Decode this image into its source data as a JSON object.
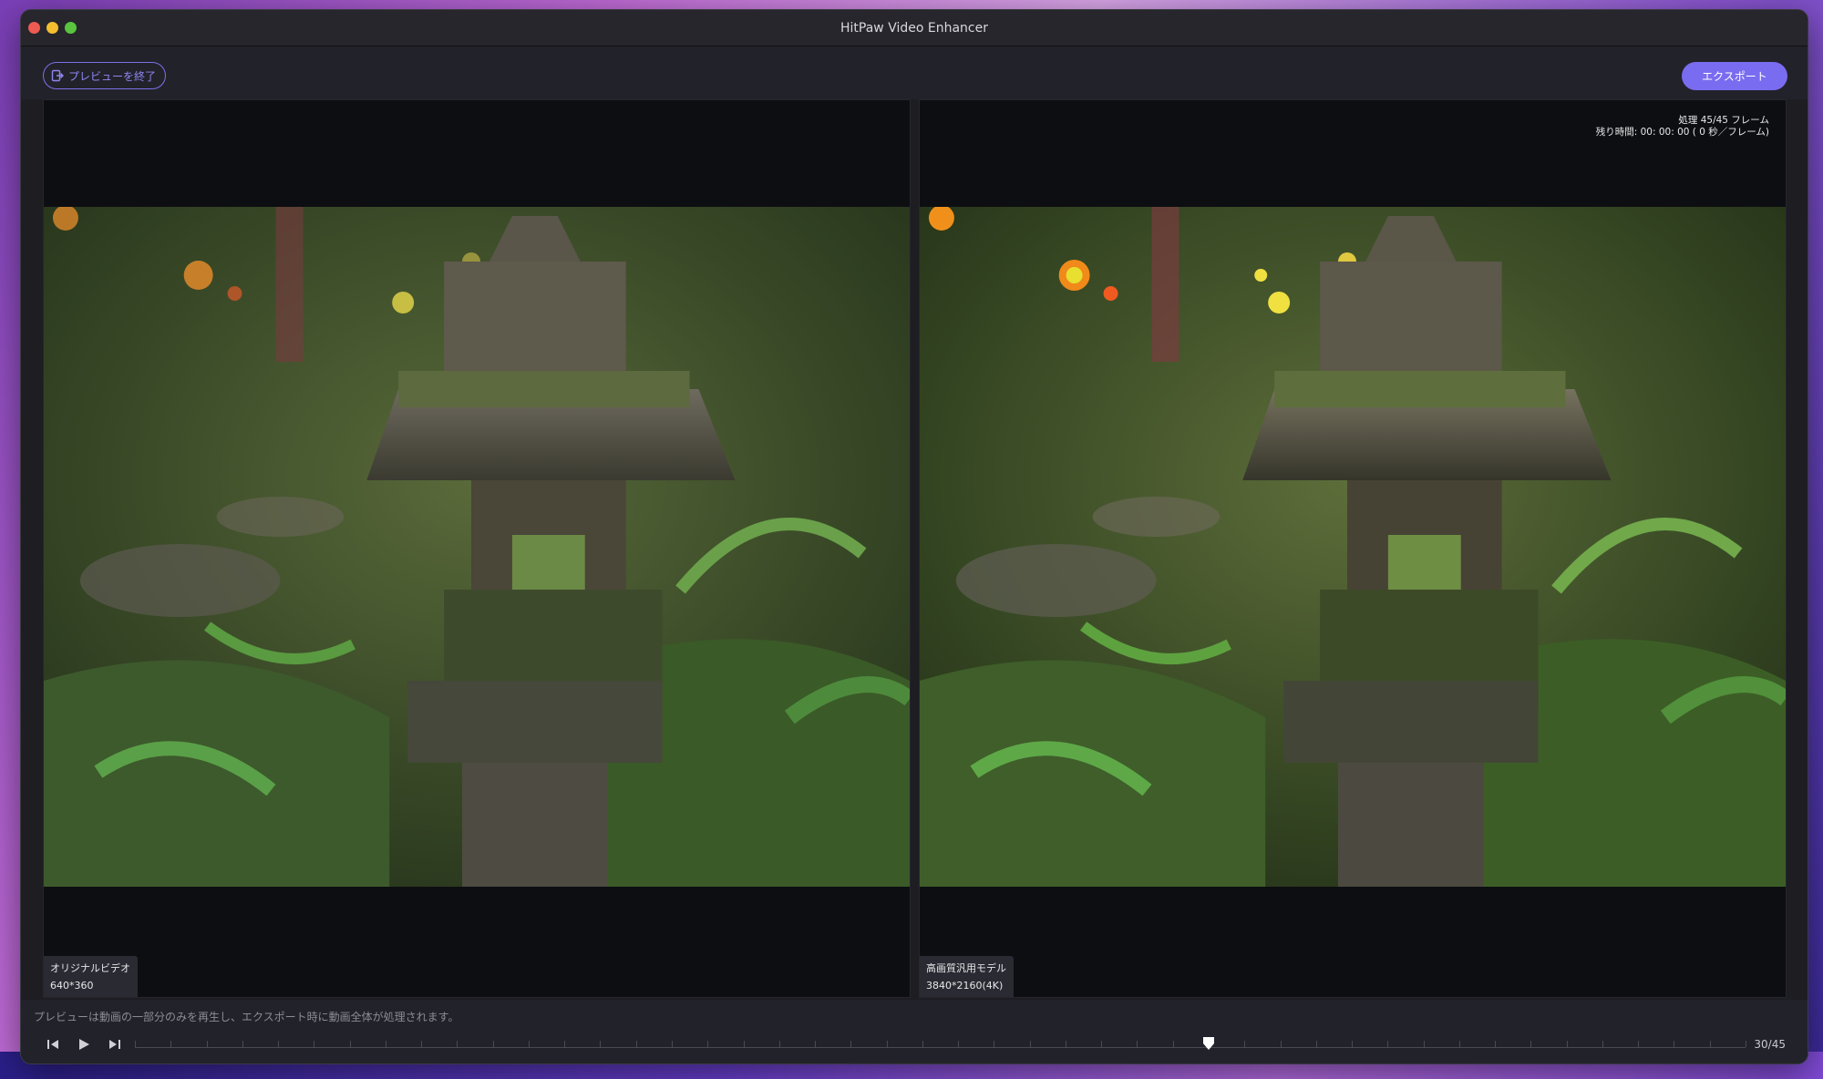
{
  "window": {
    "title": "HitPaw Video Enhancer"
  },
  "toolbar": {
    "exit_preview_label": "プレビューを終了",
    "export_label": "エクスポート"
  },
  "original": {
    "label": "オリジナルビデオ",
    "resolution": "640*360"
  },
  "enhanced": {
    "label": "高画質汎用モデル",
    "resolution": "3840*2160(4K)",
    "processing_status": "処理 45/45 フレーム",
    "remaining_time": "残り時間: 00: 00: 00 ( 0 秒／フレーム)"
  },
  "footer": {
    "notice": "プレビューは動画の一部分のみを再生し、エクスポート時に動画全体が処理されます。",
    "frame_counter": "30/45",
    "current_frame": 30,
    "total_frames": 45
  },
  "icons": {
    "exit": "exit-preview-icon",
    "prev": "previous-frame-icon",
    "play": "play-icon",
    "next": "next-frame-icon",
    "playhead": "playhead-icon"
  },
  "colors": {
    "accent": "#7a6cf0",
    "window_bg": "#1d1d22",
    "panel_bg": "#0d0e12"
  }
}
